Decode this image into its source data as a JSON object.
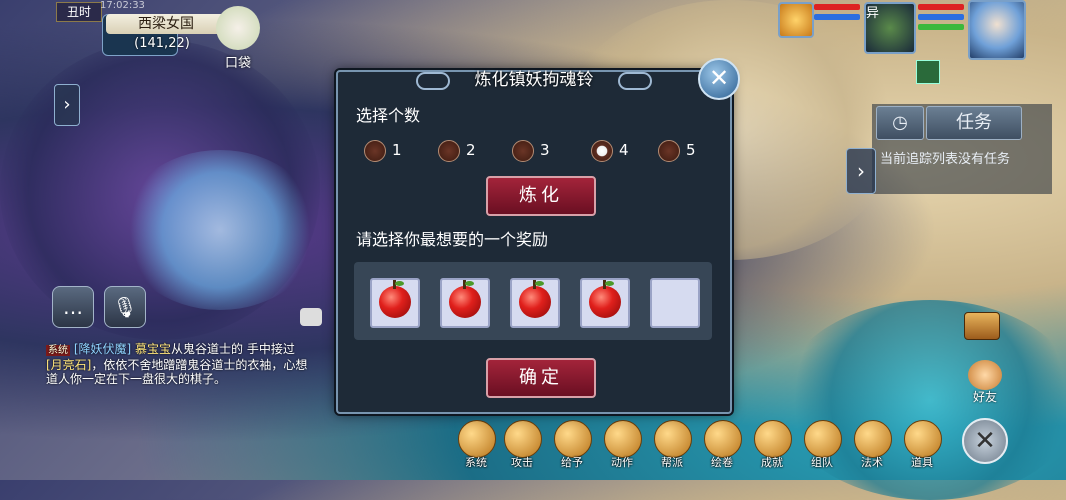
{
  "location": {
    "time_label": "丑时",
    "clock": "17:02:33",
    "map_name": "西梁女国",
    "coords": "(141,22)"
  },
  "pouch": {
    "label": "口袋"
  },
  "player": {
    "tag": "异"
  },
  "task_panel": {
    "title": "任务",
    "empty_message": "当前追踪列表没有任务"
  },
  "dialog": {
    "title": "炼化镇妖拘魂铃",
    "count_label": "选择个数",
    "counts": [
      "1",
      "2",
      "3",
      "4",
      "5"
    ],
    "selected_count": "4",
    "refine_button": "炼化",
    "reward_label": "请选择你最想要的一个奖励",
    "reward_slots": [
      {
        "item": "apple-icon"
      },
      {
        "item": "apple-icon"
      },
      {
        "item": "apple-icon"
      },
      {
        "item": "apple-icon"
      },
      {
        "item": ""
      }
    ],
    "confirm_button": "确定"
  },
  "chat": {
    "tag": "系统",
    "channel": "[降妖伏魔]",
    "player": "慕宝宝",
    "text_1": "从鬼谷道士的",
    "text_2": "手中接过",
    "item": "[月亮石]",
    "text_3": "，依依不舍地蹭蹭鬼谷道士的衣袖，心想道人你一定在下一盘很大的棋子。"
  },
  "bottom_menu": [
    {
      "label": "系统",
      "icon": "gear-icon"
    },
    {
      "label": "攻击",
      "icon": "sword-icon"
    },
    {
      "label": "给予",
      "icon": "gift-icon"
    },
    {
      "label": "动作",
      "icon": "smile-icon"
    },
    {
      "label": "帮派",
      "icon": "flag-icon"
    },
    {
      "label": "绘卷",
      "icon": "scroll-icon"
    },
    {
      "label": "成就",
      "icon": "peach-icon"
    },
    {
      "label": "组队",
      "icon": "team-icon"
    },
    {
      "label": "法术",
      "icon": "bell-icon"
    },
    {
      "label": "道具",
      "icon": "chest-icon"
    }
  ],
  "friends": {
    "label": "好友"
  },
  "colors": {
    "dialog_bg": "#1e2a37",
    "button_red": "#8a1830",
    "slot_bg": "#d6dbf0"
  }
}
